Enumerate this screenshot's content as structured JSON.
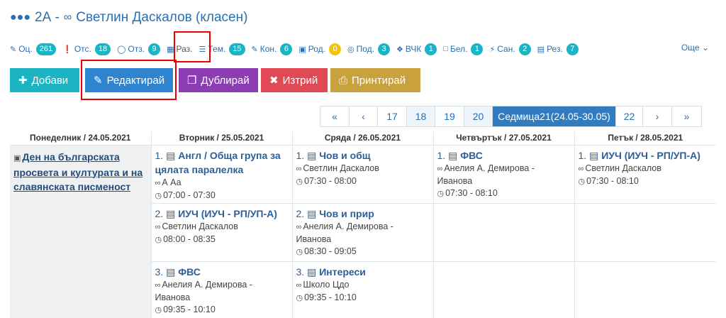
{
  "header": {
    "icon": "class-group-icon",
    "title": "2А - ",
    "teacher_icon": "glasses-icon",
    "teacher": "Светлин Даскалов (класен)"
  },
  "tabs": [
    {
      "label": "Оц.",
      "icon": "pencil-icon",
      "count": "261"
    },
    {
      "label": "Отс.",
      "icon": "alert-icon",
      "count": "18"
    },
    {
      "label": "Отз.",
      "icon": "award-icon",
      "count": "9"
    },
    {
      "label": "Раз.",
      "icon": "table-icon",
      "count": ""
    },
    {
      "label": "Тем.",
      "icon": "list-icon",
      "count": "15"
    },
    {
      "label": "Кон.",
      "icon": "edit-icon",
      "count": "6"
    },
    {
      "label": "Род.",
      "icon": "calendar-check-icon",
      "count": "0"
    },
    {
      "label": "Под.",
      "icon": "eye-icon",
      "count": "3"
    },
    {
      "label": "ВЧК",
      "icon": "handshake-icon",
      "count": "1"
    },
    {
      "label": "Бел.",
      "icon": "note-icon",
      "count": "1"
    },
    {
      "label": "Сан.",
      "icon": "bolt-icon",
      "count": "2"
    },
    {
      "label": "Рез.",
      "icon": "report-icon",
      "count": "7"
    }
  ],
  "more_label": "Още",
  "buttons": {
    "add": "Добави",
    "edit": "Редактирай",
    "duplicate": "Дублирай",
    "delete": "Изтрий",
    "print": "Принтирай"
  },
  "pager": {
    "first": "«",
    "prev": "‹",
    "p17": "17",
    "p18": "18",
    "p19": "19",
    "p20": "20",
    "current": "Седмица21(24.05-30.05)",
    "p22": "22",
    "next": "›",
    "last": "»"
  },
  "days": [
    "Понеделник / 24.05.2021",
    "Вторник / 25.05.2021",
    "Сряда / 26.05.2021",
    "Четвъртък / 27.05.2021",
    "Петък / 28.05.2021"
  ],
  "monday_event": "Ден на българската просвета и културата и на славянската писменост",
  "lessons": {
    "tue": [
      {
        "num": "1.",
        "subject": "Англ / Обща група за цялата паралелка",
        "teacher": "А Аа",
        "time": "07:00 - 07:30"
      },
      {
        "num": "2.",
        "subject": "ИУЧ (ИУЧ - РП/УП-А)",
        "teacher": "Светлин Даскалов",
        "time": "08:00 - 08:35"
      },
      {
        "num": "3.",
        "subject": "ФВС",
        "teacher": "Анелия А. Демирова - Иванова",
        "time": "09:35 - 10:10"
      }
    ],
    "wed": [
      {
        "num": "1.",
        "subject": "Чов и общ",
        "teacher": "Светлин Даскалов",
        "time": "07:30 - 08:00"
      },
      {
        "num": "2.",
        "subject": "Чов и прир",
        "teacher": "Анелия А. Демирова - Иванова",
        "time": "08:30 - 09:05"
      },
      {
        "num": "3.",
        "subject": "Интереси",
        "teacher": "Школо Цдо",
        "time": "09:35 - 10:10"
      }
    ],
    "thu": [
      {
        "num": "1.",
        "subject": "ФВС",
        "teacher": "Анелия А. Демирова - Иванова",
        "time": "07:30 - 08:10"
      }
    ],
    "fri": [
      {
        "num": "1.",
        "subject": "ИУЧ (ИУЧ - РП/УП-А)",
        "teacher": "Светлин Даскалов",
        "time": "07:30 - 08:10"
      }
    ]
  },
  "colors": {
    "primary": "#2a6fb0",
    "teal": "#1cb4c2",
    "blue": "#2f84d0",
    "purple": "#8c3db3",
    "red": "#e04a55",
    "gold": "#c9a13d",
    "badge": "#1ab5c4",
    "badge_yellow": "#f3c20f",
    "highlight": "#ee0000"
  }
}
